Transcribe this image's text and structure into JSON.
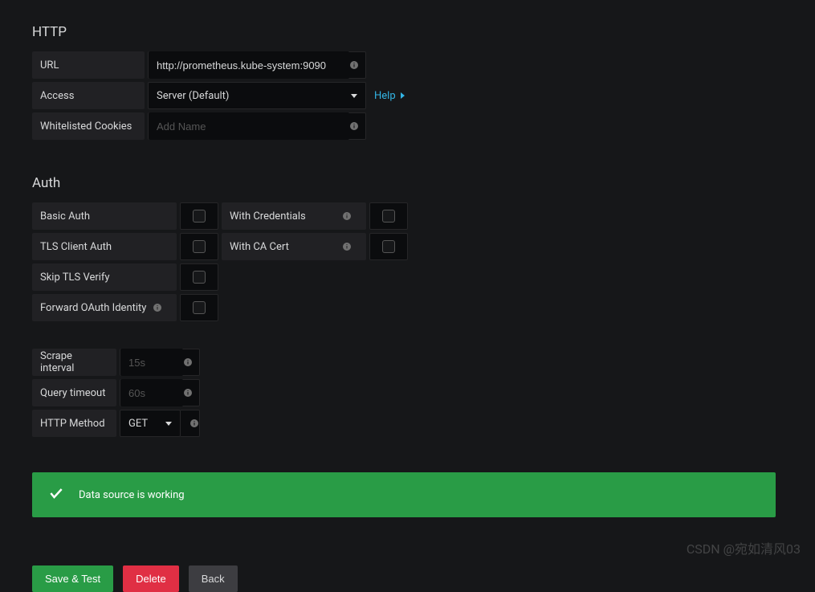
{
  "sections": {
    "http": "HTTP",
    "auth": "Auth"
  },
  "http": {
    "url_label": "URL",
    "url_value": "http://prometheus.kube-system:9090",
    "access_label": "Access",
    "access_value": "Server (Default)",
    "help": "Help",
    "cookies_label": "Whitelisted Cookies",
    "cookies_placeholder": "Add Name"
  },
  "auth": {
    "basic": "Basic Auth",
    "with_credentials": "With Credentials",
    "tls_client": "TLS Client Auth",
    "with_ca": "With CA Cert",
    "skip_tls": "Skip TLS Verify",
    "forward_oauth": "Forward OAuth Identity"
  },
  "prom": {
    "scrape_label": "Scrape interval",
    "scrape_placeholder": "15s",
    "query_label": "Query timeout",
    "query_placeholder": "60s",
    "http_method_label": "HTTP Method",
    "http_method_value": "GET"
  },
  "alert": {
    "message": "Data source is working"
  },
  "buttons": {
    "save_test": "Save & Test",
    "delete": "Delete",
    "back": "Back"
  },
  "watermark": "CSDN @宛如清风03"
}
